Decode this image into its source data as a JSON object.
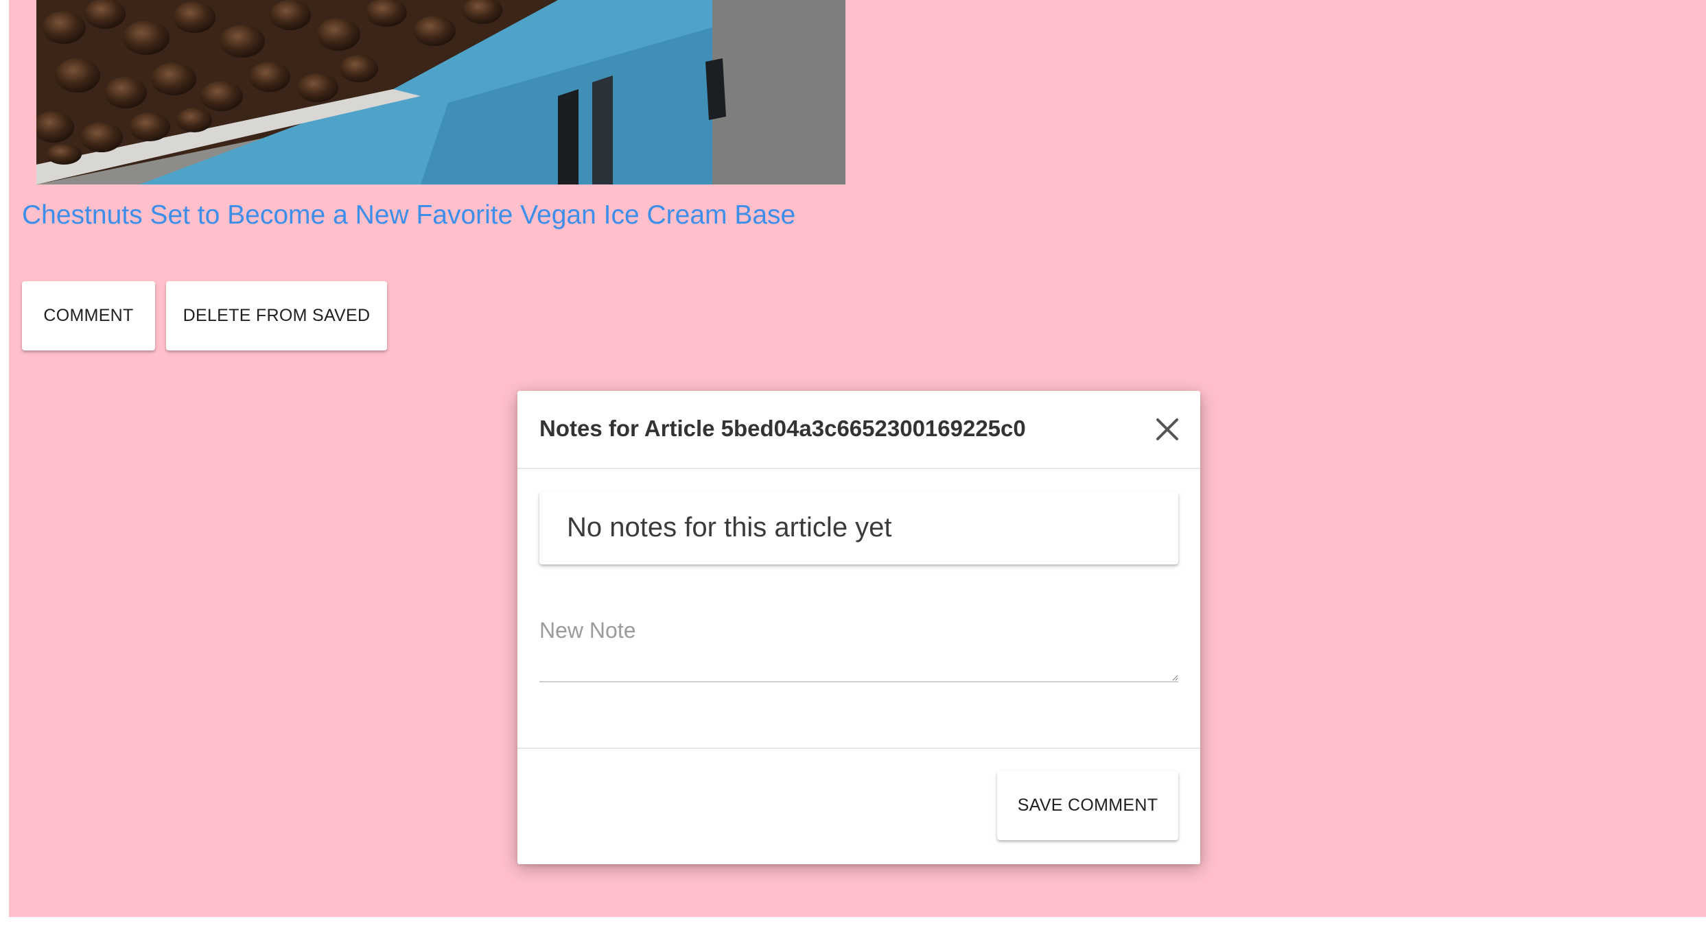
{
  "article": {
    "image_alt": "chestnuts",
    "title": "Chestnuts Set to Become a New Favorite Vegan Ice Cream Base"
  },
  "actions": {
    "comment_label": "COMMENT",
    "delete_label": "DELETE FROM SAVED"
  },
  "modal": {
    "title": "Notes for Article 5bed04a3c6652300169225c0",
    "close_icon": "close-icon",
    "empty_notes": "No notes for this article yet",
    "new_note_placeholder": "New Note",
    "new_note_value": "",
    "save_label": "SAVE COMMENT"
  },
  "colors": {
    "page_background": "#ffc0cb",
    "title_link": "#3d8ee8",
    "crate_blue": "#4fa3c9"
  }
}
